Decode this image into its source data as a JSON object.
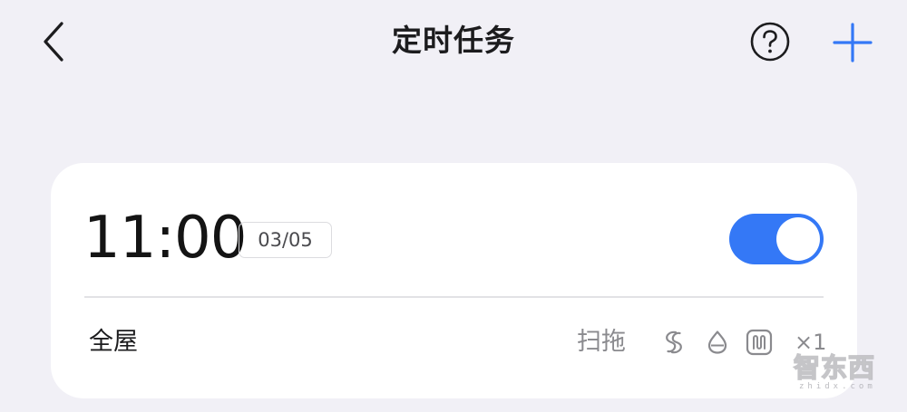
{
  "header": {
    "title": "定时任务",
    "back_icon": "chevron-left-icon",
    "help_icon": "question-circle-icon",
    "add_icon": "plus-icon",
    "accent_color": "#3478f6"
  },
  "task": {
    "time": "11:00",
    "date": "03/05",
    "enabled": true,
    "area": "全屋",
    "mode": "扫拖",
    "suction_icon": "suction-swirl-icon",
    "water_icon": "water-drop-icon",
    "route_icon": "cleaning-route-icon",
    "repeat": "×1"
  },
  "watermark": {
    "text": "智东西",
    "sub": "zhidx.com"
  }
}
